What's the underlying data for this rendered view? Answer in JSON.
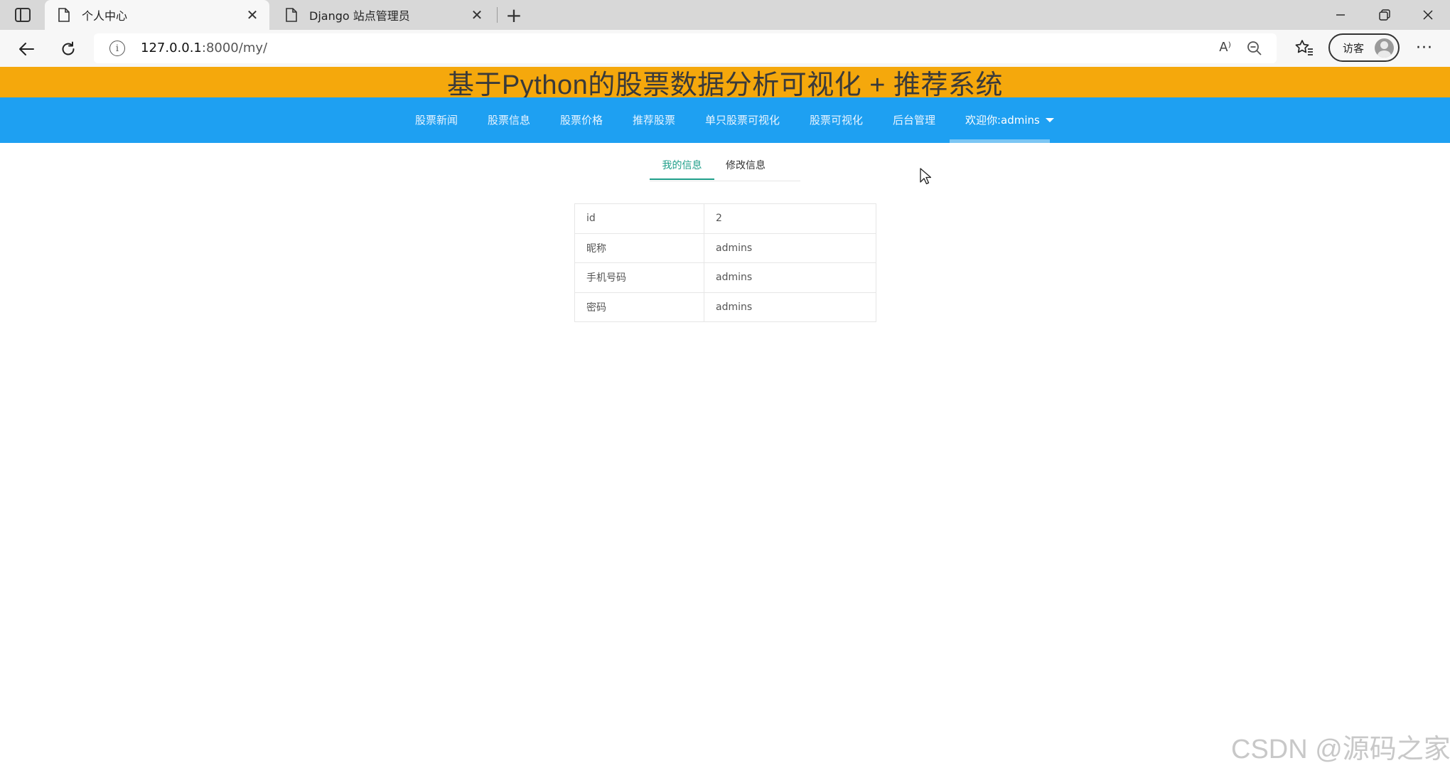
{
  "browser": {
    "tabs": [
      {
        "title": "个人中心",
        "active": true
      },
      {
        "title": "Django 站点管理员",
        "active": false
      }
    ],
    "url_host": "127.0.0.1",
    "url_rest": ":8000/my/",
    "read_aloud_icon_text": "A⁾",
    "profile_label": "访客",
    "more_label": "···"
  },
  "page": {
    "banner_title": "基于Python的股票数据分析可视化 + 推荐系统",
    "nav": {
      "items": [
        "股票新闻",
        "股票信息",
        "股票价格",
        "推荐股票",
        "单只股票可视化",
        "股票可视化",
        "后台管理"
      ],
      "user_menu": "欢迎你:admins"
    },
    "subtabs": [
      "我的信息",
      "修改信息"
    ],
    "profile_rows": [
      {
        "key": "id",
        "value": "2"
      },
      {
        "key": "昵称",
        "value": "admins"
      },
      {
        "key": "手机号码",
        "value": "admins"
      },
      {
        "key": "密码",
        "value": "admins"
      }
    ]
  },
  "watermark": "CSDN @源码之家",
  "colors": {
    "banner": "#f5a80c",
    "navbar": "#1ea0f2",
    "active_subtab": "#1e9e89"
  }
}
